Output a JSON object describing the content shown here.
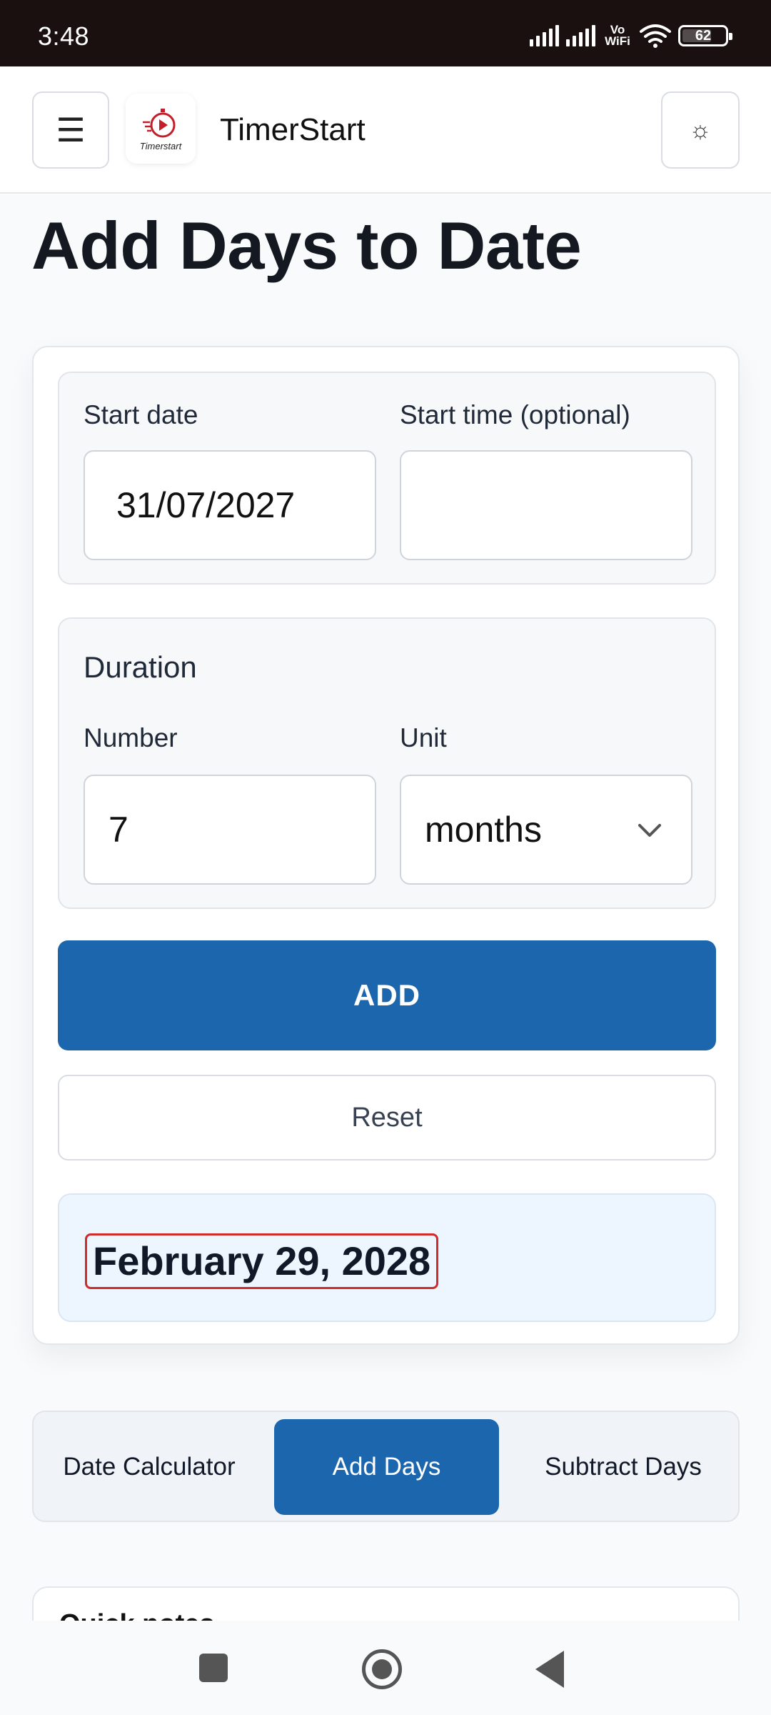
{
  "status_bar": {
    "time": "3:48",
    "network_label_top": "Vo",
    "network_label_bottom": "WiFi",
    "battery_level": "62"
  },
  "header": {
    "menu_icon": "hamburger-icon",
    "logo_text": "Timerstart",
    "app_title": "TimerStart",
    "theme_icon": "sun-icon"
  },
  "page": {
    "title": "Add Days to Date"
  },
  "start": {
    "date_label": "Start date",
    "date_value": "31/07/2027",
    "time_label": "Start time (optional)",
    "time_value": ""
  },
  "duration": {
    "heading": "Duration",
    "number_label": "Number",
    "number_value": "7",
    "unit_label": "Unit",
    "unit_value": "months"
  },
  "actions": {
    "add_label": "ADD",
    "reset_label": "Reset"
  },
  "result": {
    "text": "February 29, 2028"
  },
  "tabs": [
    {
      "label": "Date Calculator",
      "active": false
    },
    {
      "label": "Add Days",
      "active": true
    },
    {
      "label": "Subtract Days",
      "active": false
    }
  ],
  "next_section": {
    "title": "Quick notes"
  },
  "colors": {
    "primary": "#1c66ae",
    "result_bg": "#edf5ff",
    "highlight_border": "#d12b2b",
    "status_bar_bg": "#1a1010"
  }
}
